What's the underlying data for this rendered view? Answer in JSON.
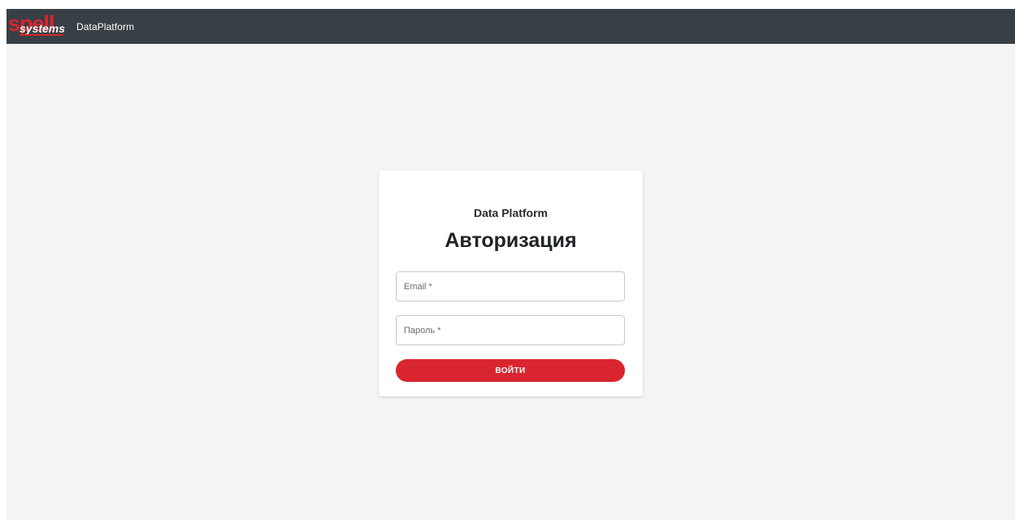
{
  "header": {
    "logo_text": "spell systems",
    "app_name": "DataPlatform"
  },
  "login": {
    "subtitle": "Data Platform",
    "title": "Авторизация",
    "email_placeholder": "Email *",
    "password_placeholder": "Пароль *",
    "submit_label": "ВОЙТИ"
  },
  "colors": {
    "topbar": "#383f45",
    "background": "#f4f4f4",
    "accent": "#d9252f"
  }
}
